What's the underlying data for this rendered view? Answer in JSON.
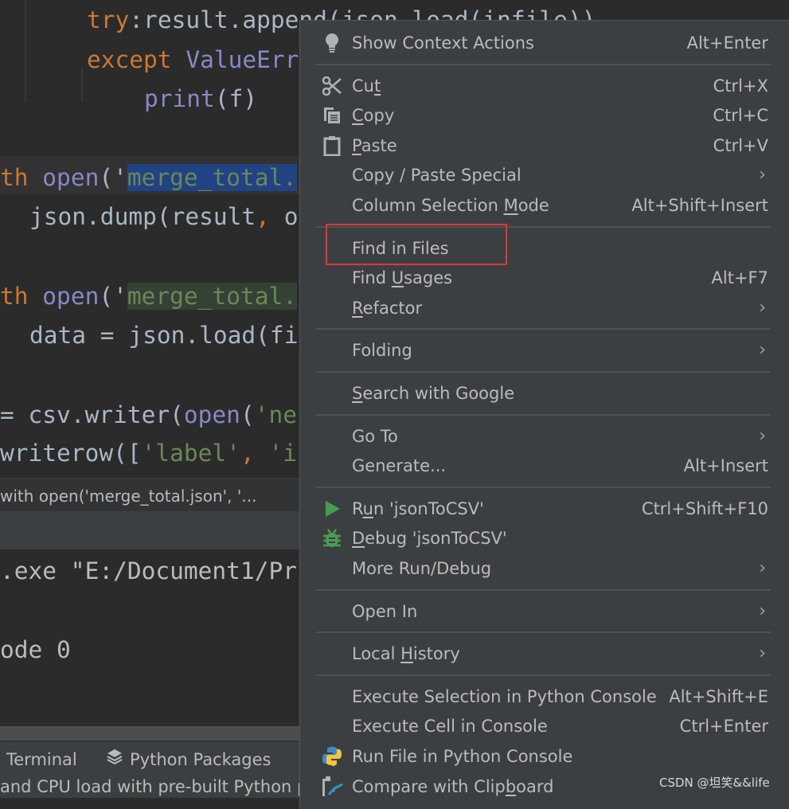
{
  "editor": {
    "lines": [
      {
        "tokens": [
          [
            "try",
            "kw"
          ],
          [
            ":result.append(json.load(infile))",
            "def"
          ]
        ]
      },
      {
        "tokens": [
          [
            "except",
            "kw"
          ],
          [
            " ",
            "def"
          ],
          [
            "ValueErr",
            "bi"
          ]
        ]
      },
      {
        "tokens": [
          [
            "print",
            "bi"
          ],
          [
            "(f)",
            "def"
          ]
        ]
      },
      {
        "tokens": [
          [
            "th",
            "kw"
          ],
          [
            " ",
            "def"
          ],
          [
            "open",
            "bi"
          ],
          [
            "('",
            "def"
          ],
          [
            "merge_total.",
            "str sel"
          ]
        ]
      },
      {
        "tokens": [
          [
            "json.dump(result",
            "def"
          ],
          [
            ",",
            "kw"
          ],
          [
            " o",
            "def"
          ]
        ]
      },
      {
        "tokens": [
          [
            "th",
            "kw"
          ],
          [
            " ",
            "def"
          ],
          [
            "open",
            "bi"
          ],
          [
            "('",
            "def"
          ],
          [
            "merge_total.",
            "str grn"
          ]
        ]
      },
      {
        "tokens": [
          [
            "data = json.load(fi",
            "def"
          ]
        ]
      },
      {
        "tokens": [
          [
            "= csv.writer(",
            "def"
          ],
          [
            "open",
            "bi"
          ],
          [
            "(",
            "def"
          ],
          [
            "'ne",
            "str"
          ]
        ]
      },
      {
        "tokens": [
          [
            "writerow([",
            "def"
          ],
          [
            "'label'",
            "str"
          ],
          [
            ",",
            "kw"
          ],
          [
            " ",
            "def"
          ],
          [
            "'i",
            "str"
          ]
        ]
      }
    ]
  },
  "breadcrumb": "with open('merge_total.json', '...",
  "console": {
    "lines": [
      ".exe \"E:/Document1/Pr",
      "ode 0"
    ]
  },
  "tool_tabs": [
    {
      "label": "Terminal",
      "icon": "terminal-icon"
    },
    {
      "label": "Python Packages",
      "icon": "layers-icon"
    }
  ],
  "status_text": "and CPU load with pre-built Python pa",
  "context_menu": {
    "highlighted_item": "Find in Files",
    "highlight_color": "#e0373a",
    "items": [
      {
        "type": "item",
        "pre": "Show Context Actions",
        "key": "",
        "post": "",
        "shortcut": "Alt+Enter",
        "icon": "lightbulb-icon"
      },
      {
        "type": "sep"
      },
      {
        "type": "item",
        "pre": "Cu",
        "key": "t",
        "post": "",
        "shortcut": "Ctrl+X",
        "icon": "scissors-icon"
      },
      {
        "type": "item",
        "pre": "",
        "key": "C",
        "post": "opy",
        "shortcut": "Ctrl+C",
        "icon": "copy-icon"
      },
      {
        "type": "item",
        "pre": "",
        "key": "P",
        "post": "aste",
        "shortcut": "Ctrl+V",
        "icon": "clipboard-icon"
      },
      {
        "type": "item",
        "pre": "Copy / Paste Special",
        "key": "",
        "post": "",
        "submenu": true
      },
      {
        "type": "item",
        "pre": "Column Selection ",
        "key": "M",
        "post": "ode",
        "shortcut": "Alt+Shift+Insert"
      },
      {
        "type": "sep"
      },
      {
        "type": "item",
        "pre": "Find in Files",
        "key": "",
        "post": "",
        "highlight": true
      },
      {
        "type": "item",
        "pre": "Find ",
        "key": "U",
        "post": "sages",
        "shortcut": "Alt+F7"
      },
      {
        "type": "item",
        "pre": "",
        "key": "R",
        "post": "efactor",
        "submenu": true
      },
      {
        "type": "sep"
      },
      {
        "type": "item",
        "pre": "Folding",
        "key": "",
        "post": "",
        "submenu": true
      },
      {
        "type": "sep"
      },
      {
        "type": "item",
        "pre": "",
        "key": "S",
        "post": "earch with Google"
      },
      {
        "type": "sep"
      },
      {
        "type": "item",
        "pre": "Go To",
        "key": "",
        "post": "",
        "submenu": true
      },
      {
        "type": "item",
        "pre": "Generate...",
        "key": "",
        "post": "",
        "shortcut": "Alt+Insert"
      },
      {
        "type": "sep"
      },
      {
        "type": "item",
        "pre": "R",
        "key": "u",
        "post": "n 'jsonToCSV'",
        "shortcut": "Ctrl+Shift+F10",
        "icon": "run-icon"
      },
      {
        "type": "item",
        "pre": "",
        "key": "D",
        "post": "ebug 'jsonToCSV'",
        "icon": "debug-bug-icon"
      },
      {
        "type": "item",
        "pre": "More Run/Debug",
        "key": "",
        "post": "",
        "submenu": true
      },
      {
        "type": "sep"
      },
      {
        "type": "item",
        "pre": "Open In",
        "key": "",
        "post": "",
        "submenu": true
      },
      {
        "type": "sep"
      },
      {
        "type": "item",
        "pre": "Local ",
        "key": "H",
        "post": "istory",
        "submenu": true
      },
      {
        "type": "sep"
      },
      {
        "type": "item",
        "pre": "Execute Selection in Python Console",
        "key": "",
        "post": "",
        "shortcut": "Alt+Shift+E"
      },
      {
        "type": "item",
        "pre": "Execute Cell in Console",
        "key": "",
        "post": "",
        "shortcut": "Ctrl+Enter"
      },
      {
        "type": "item",
        "pre": "Run File in Python Console",
        "key": "",
        "post": "",
        "icon": "python-icon"
      },
      {
        "type": "item",
        "pre": "Compare with Clip",
        "key": "b",
        "post": "oard",
        "icon": "compare-icon"
      }
    ]
  },
  "watermark": "CSDN @坦笑&&life"
}
